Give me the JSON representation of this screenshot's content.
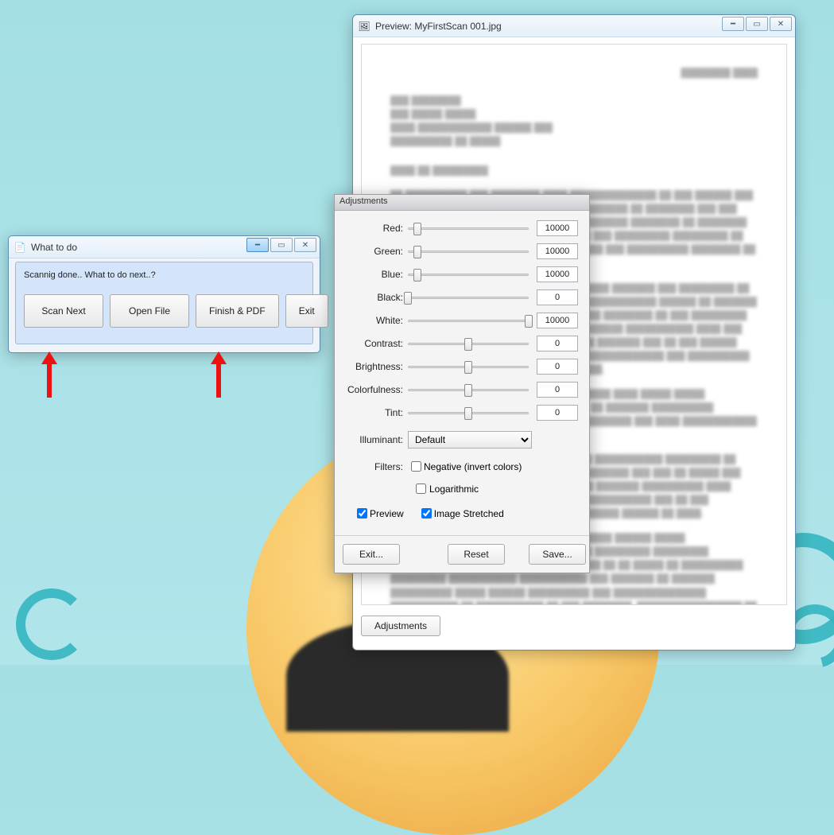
{
  "preview": {
    "title": "Preview: MyFirstScan 001.jpg",
    "adjustments_button": "Adjustments"
  },
  "wtd": {
    "title": "What to do",
    "message": "Scannig done.. What to do next..?",
    "buttons": {
      "scan_next": "Scan Next",
      "open_file": "Open File",
      "finish_pdf": "Finish & PDF",
      "exit": "Exit"
    }
  },
  "adjustments": {
    "title": "Adjustments",
    "sliders": {
      "red": {
        "label": "Red:",
        "value": "10000",
        "pos": 8
      },
      "green": {
        "label": "Green:",
        "value": "10000",
        "pos": 8
      },
      "blue": {
        "label": "Blue:",
        "value": "10000",
        "pos": 8
      },
      "black": {
        "label": "Black:",
        "value": "0",
        "pos": 0
      },
      "white": {
        "label": "White:",
        "value": "10000",
        "pos": 100
      },
      "contrast": {
        "label": "Contrast:",
        "value": "0",
        "pos": 50
      },
      "brightness": {
        "label": "Brightness:",
        "value": "0",
        "pos": 50
      },
      "colorfulness": {
        "label": "Colorfulness:",
        "value": "0",
        "pos": 50
      },
      "tint": {
        "label": "Tint:",
        "value": "0",
        "pos": 50
      }
    },
    "illuminant": {
      "label": "Illuminant:",
      "value": "Default"
    },
    "filters": {
      "label": "Filters:",
      "negative": "Negative (invert colors)",
      "logarithmic": "Logarithmic"
    },
    "checks": {
      "preview": "Preview",
      "stretched": "Image Stretched"
    },
    "buttons": {
      "exit": "Exit...",
      "reset": "Reset",
      "save": "Save..."
    }
  }
}
